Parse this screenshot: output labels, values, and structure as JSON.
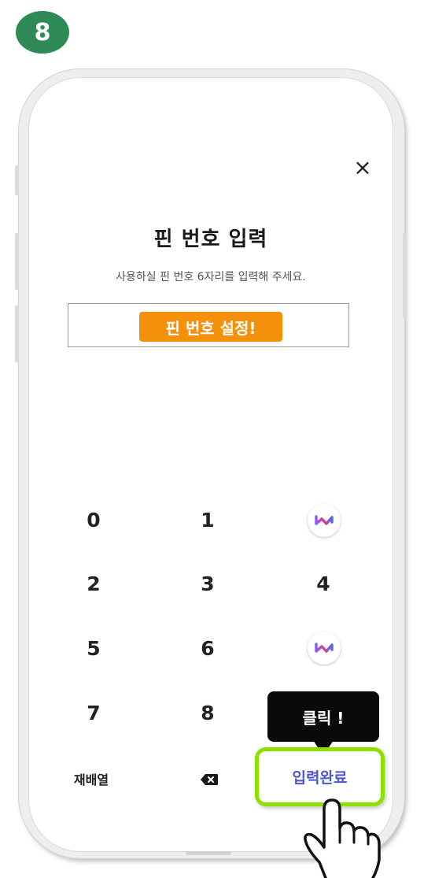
{
  "step_number": "8",
  "dialog": {
    "close_symbol": "×",
    "title": "핀 번호 입력",
    "subtitle": "사용하실 핀 번호 6자리를 입력해 주세요.",
    "pin_label": "핀 번호 설정!"
  },
  "keypad": {
    "keys": [
      "0",
      "1",
      "2",
      "3",
      "4",
      "5",
      "6",
      "7",
      "8"
    ],
    "rearrange_label": "재배열",
    "confirm_label": "입력완료",
    "logo_icon": "brand-logo-icon",
    "backspace_icon": "backspace-icon"
  },
  "annotation": {
    "tooltip": "클릭 !",
    "pointer_icon": "hand-pointer-icon",
    "highlight_color": "#8ee000"
  },
  "colors": {
    "badge": "#2e8a57",
    "pin_label_bg": "#f5900a",
    "confirm_text": "#4a55d2"
  }
}
